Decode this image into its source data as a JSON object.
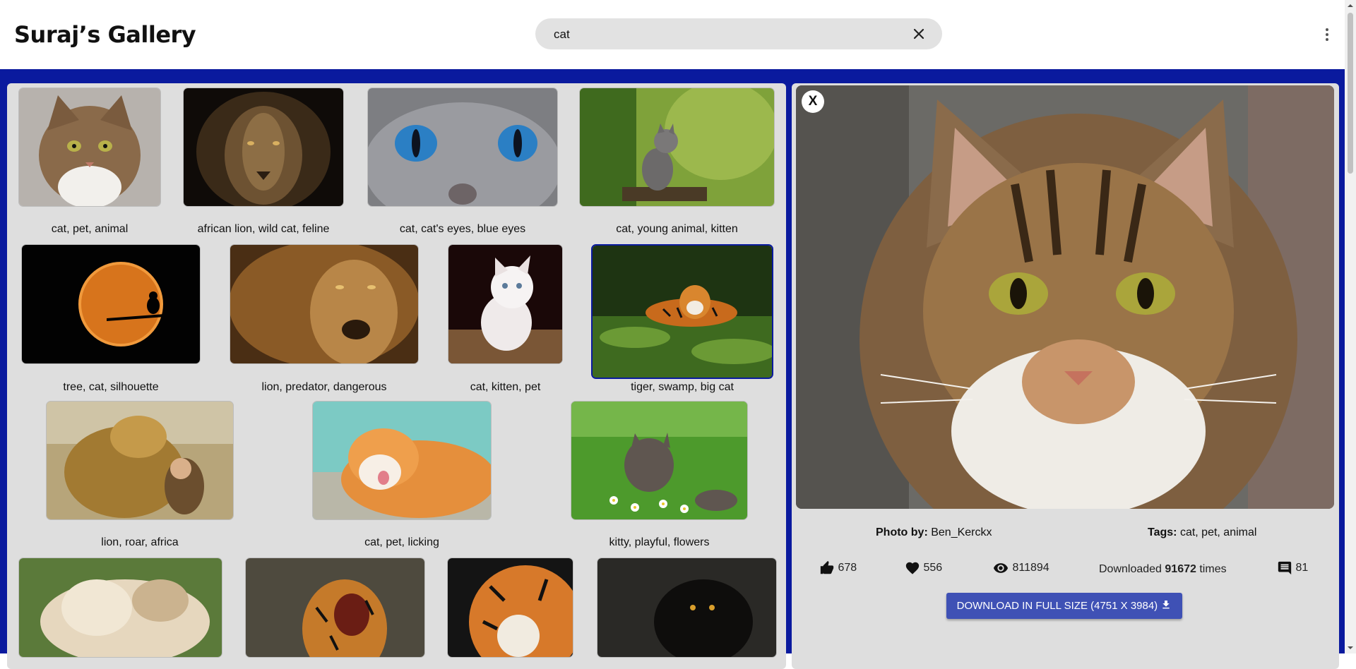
{
  "header": {
    "title": "Suraj’s Gallery",
    "search_value": "cat",
    "icons": {
      "clear": "close-icon",
      "menu": "more-vert-icon"
    }
  },
  "gallery": [
    {
      "caption": "cat, pet, animal",
      "image": "tabby-cat"
    },
    {
      "caption": "african lion, wild cat, feline",
      "image": "dark-lion"
    },
    {
      "caption": "cat, cat's eyes, blue eyes",
      "image": "blue-eyed-cat"
    },
    {
      "caption": "cat, young animal, kitten",
      "image": "kitten-on-branch"
    },
    {
      "caption": "tree, cat, silhouette",
      "image": "moon-silhouette"
    },
    {
      "caption": "lion, predator, dangerous",
      "image": "lion-mane"
    },
    {
      "caption": "cat, kitten, pet",
      "image": "white-kitten"
    },
    {
      "caption": "tiger, swamp, big cat",
      "image": "tiger-swamp"
    },
    {
      "caption": "lion, roar, africa",
      "image": "lion-and-girl"
    },
    {
      "caption": "cat, pet, licking",
      "image": "ginger-cat-licking"
    },
    {
      "caption": "kitty, playful, flowers",
      "image": "kitten-in-flowers"
    },
    {
      "caption": "",
      "image": "cat-and-dog"
    },
    {
      "caption": "",
      "image": "roaring-tiger"
    },
    {
      "caption": "",
      "image": "tiger-face"
    },
    {
      "caption": "",
      "image": "black-cat"
    }
  ],
  "selected_index": 7,
  "detail": {
    "close_label": "X",
    "photo_by_label": "Photo by:",
    "photo_by": "Ben_Kerckx",
    "tags_label": "Tags:",
    "tags": "cat, pet, animal",
    "likes": "678",
    "favorites": "556",
    "views": "811894",
    "downloaded_prefix": "Downloaded",
    "downloads": "91672",
    "downloaded_suffix": "times",
    "comments": "81",
    "download_button": "DOWNLOAD IN FULL SIZE (4751 X 3984)"
  },
  "colors": {
    "accent_background": "#0a1a9e",
    "panel": "#dedede",
    "button": "#3f51b5",
    "search_bg": "#e2e2e2"
  }
}
